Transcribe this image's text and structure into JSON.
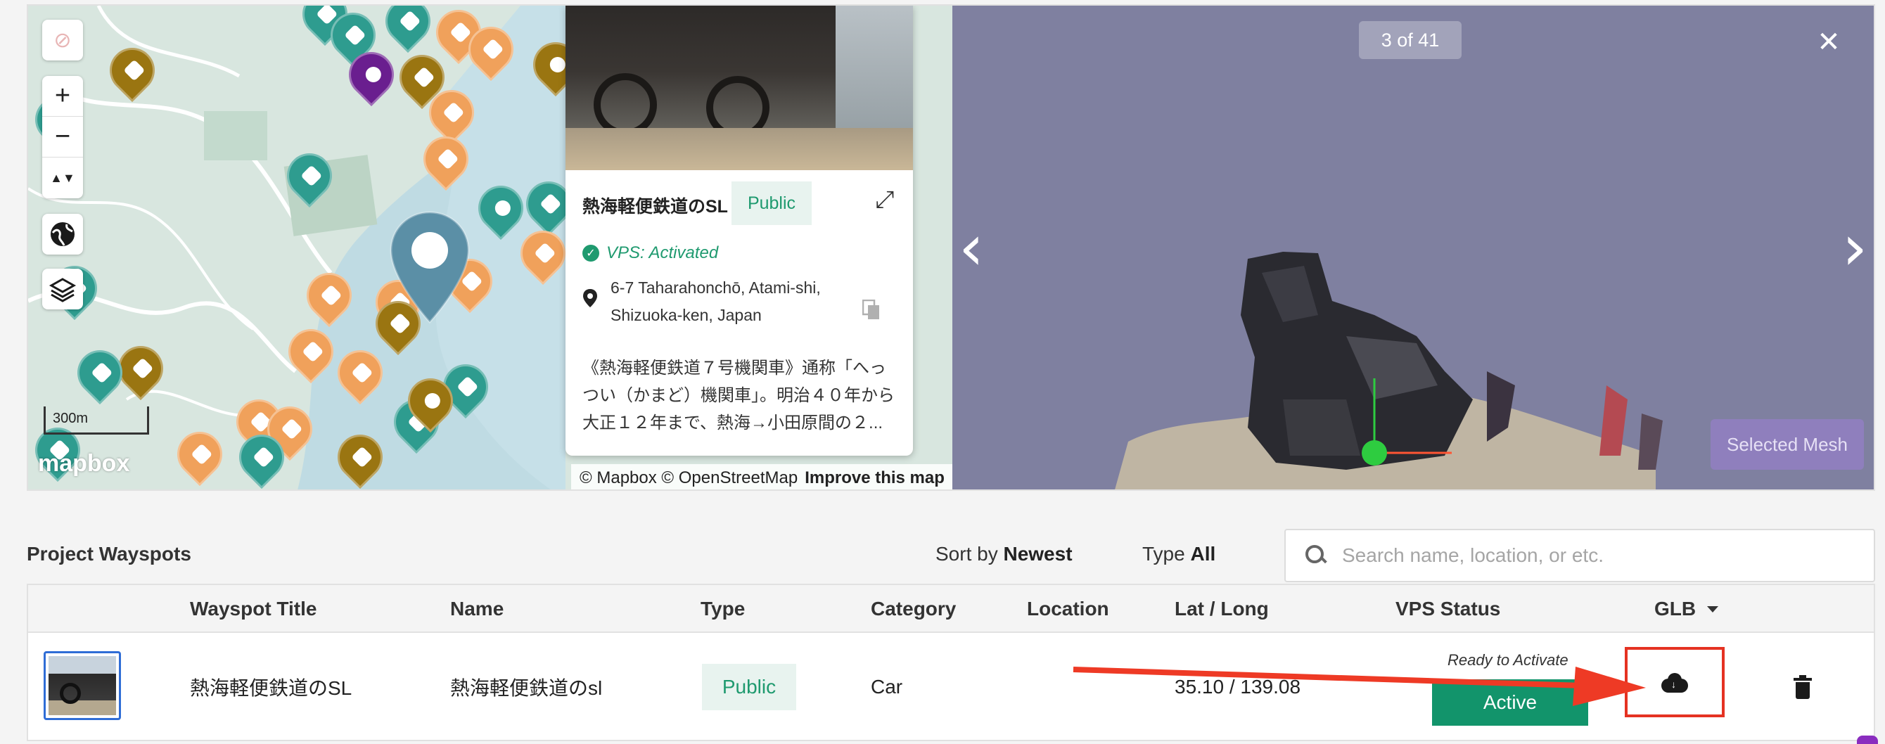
{
  "map": {
    "scale_label": "300m",
    "logo_text": "mapbox",
    "attribution": "© Mapbox © OpenStreetMap",
    "improve_link": "Improve this map",
    "controls": {
      "zoom_in": "+",
      "zoom_out": "−",
      "compass": "▲▼"
    }
  },
  "popup": {
    "title": "熱海軽便鉄道のSL",
    "badge": "Public",
    "vps_status": "VPS: Activated",
    "address_line1": "6-7 Taharahonchō, Atami-shi,",
    "address_line2": "Shizuoka-ken, Japan",
    "description": "《熱海軽便鉄道７号機関車》通称「へっつい（かまど）機関車」。明治４０年から大正１２年まで、熱海→小田原間の２..."
  },
  "viewer": {
    "counter": "3 of 41",
    "selected_mesh_label": "Selected Mesh"
  },
  "list": {
    "section_title": "Project Wayspots",
    "sort_prefix": "Sort by",
    "sort_value": "Newest",
    "type_prefix": "Type",
    "type_value": "All",
    "search_placeholder": "Search name, location, or etc."
  },
  "table": {
    "columns": [
      "Wayspot Title",
      "Name",
      "Type",
      "Category",
      "Location",
      "Lat / Long",
      "VPS Status",
      "GLB"
    ],
    "rows": [
      {
        "wayspot_title": "熱海軽便鉄道のSL",
        "name": "熱海軽便鉄道のsl",
        "type": "Public",
        "category": "Car",
        "location": "",
        "lat_long": "35.10 / 139.08",
        "vps_hint": "Ready to Activate",
        "vps_button": "Active"
      }
    ]
  },
  "colors": {
    "accent_green": "#12946b",
    "highlight_red": "#e53222",
    "viewer_bg": "#7f80a0",
    "mesh_button": "#8f7fbd"
  },
  "icons": [
    "location-off-icon",
    "globe-icon",
    "layers-icon",
    "expand-icon",
    "check-circle-icon",
    "map-pin-icon",
    "copy-icon",
    "close-icon",
    "chevron-left-icon",
    "chevron-right-icon",
    "search-icon",
    "caret-down-icon",
    "cloud-download-icon",
    "trash-icon"
  ]
}
